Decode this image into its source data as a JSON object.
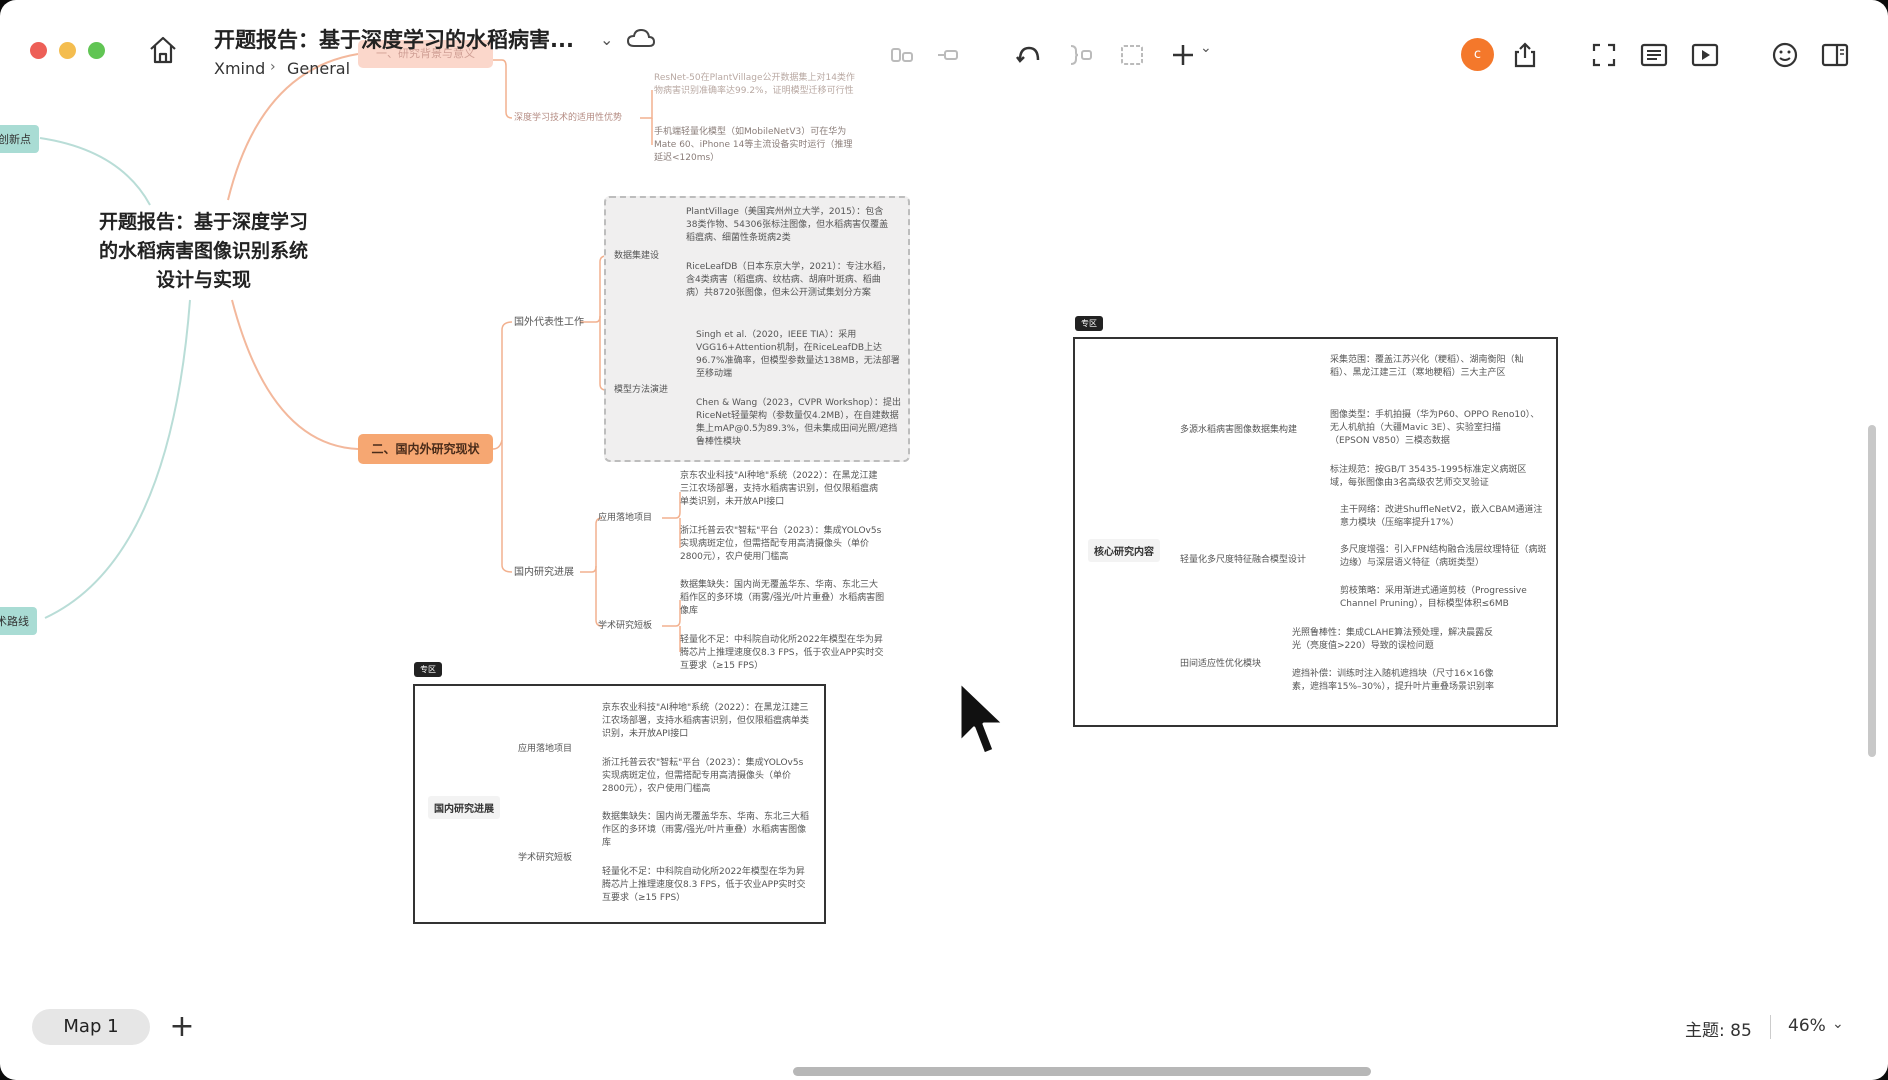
{
  "title_bar": {
    "doc_title": "开题报告：基于深度学习的水稻病害...",
    "breadcrumb": [
      "Xmind",
      "General"
    ],
    "avatar_letter": "c"
  },
  "toolbar_icons": [
    "relationship-icon",
    "boundary-icon",
    "undo-icon",
    "summary-icon",
    "frame-icon",
    "add-icon",
    "share-icon",
    "fullscreen-icon",
    "outline-icon",
    "play-icon",
    "emoji-icon",
    "panel-icon"
  ],
  "mindmap": {
    "root": "开题报告：基于深度学习的水稻病害图像识别系统设计与实现",
    "left_nodes": [
      "创新点",
      "术路线"
    ],
    "faded_node": "一、研究背景与意义",
    "top_faded_leaves": [
      "ResNet-50在PlantVillage公开数据集上对14类作物病害识别准确率达99.2%，证明模型迁移可行性",
      "手机端轻量化模型（如MobileNetV3）可在华为Mate 60、iPhone 14等主流设备实时运行（推理延迟<120ms）"
    ],
    "top_faded_branch": "深度学习技术的适用性优势",
    "domestic_status": "二、国内外研究现状",
    "foreign_work": "国外代表性工作",
    "dataset_build": "数据集建设",
    "model_evolution": "模型方法演进",
    "domestic_progress": "国内研究进展",
    "app_projects": "应用落地项目",
    "academic_gaps": "学术研究短板",
    "leaves": {
      "plantvillage": "PlantVillage（美国宾州州立大学，2015）：包含38类作物、54306张标注图像，但水稻病害仅覆盖稻瘟病、细菌性条斑病2类",
      "riceleaf": "RiceLeafDB（日本东京大学，2021）：专注水稻，含4类病害（稻瘟病、纹枯病、胡麻叶斑病、稻曲病）共8720张图像，但未公开测试集划分方案",
      "singh": "Singh et al.（2020，IEEE TIA）：采用VGG16+Attention机制，在RiceLeafDB上达96.7%准确率，但模型参数量达138MB，无法部署至移动端",
      "chen": "Chen & Wang（2023，CVPR Workshop）：提出RiceNet轻量架构（参数量仅4.2MB），在自建数据集上mAP@0.5为89.3%，但未集成田间光照/遮挡鲁棒性模块",
      "jd": "京东农业科技\"AI种地\"系统（2022）：在黑龙江建三江农场部署，支持水稻病害识别，但仅限稻瘟病单类识别，未开放API接口",
      "zj": "浙江托普云农\"智耘\"平台（2023）：集成YOLOv5s实现病斑定位，但需搭配专用高清摄像头（单价2800元），农户使用门槛高",
      "data_gap": "数据集缺失：国内尚无覆盖华东、华南、东北三大稻作区的多环境（雨雾/强光/叶片重叠）水稻病害图像库",
      "light_gap": "轻量化不足：中科院自动化所2022年模型在华为昇腾芯片上推理速度仅8.3 FPS，低于农业APP实时交互要求（≥15 FPS）"
    },
    "zone_tag": "专区",
    "zone1": {
      "center": "国内研究进展",
      "app_projects": "应用落地项目",
      "academic_gaps": "学术研究短板",
      "jd": "京东农业科技\"AI种地\"系统（2022）：在黑龙江建三江农场部署，支持水稻病害识别，但仅限稻瘟病单类识别，未开放API接口",
      "zj": "浙江托普云农\"智耘\"平台（2023）：集成YOLOv5s实现病斑定位，但需搭配专用高清摄像头（单价2800元），农户使用门槛高",
      "data_gap": "数据集缺失：国内尚无覆盖华东、华南、东北三大稻作区的多环境（雨雾/强光/叶片重叠）水稻病害图像库",
      "light_gap": "轻量化不足：中科院自动化所2022年模型在华为昇腾芯片上推理速度仅8.3 FPS，低于农业APP实时交互要求（≥15 FPS）"
    },
    "zone2": {
      "center": "核心研究内容",
      "branch1": "多源水稻病害图像数据集构建",
      "branch2": "轻量化多尺度特征融合模型设计",
      "branch3": "田间适应性优化模块",
      "leaf1": "采集范围：覆盖江苏兴化（粳稻）、湖南衡阳（籼稻）、黑龙江建三江（寒地粳稻）三大主产区",
      "leaf2": "图像类型：手机拍摄（华为P60、OPPO Reno10）、无人机航拍（大疆Mavic 3E）、实验室扫描（EPSON V850）三模态数据",
      "leaf3": "标注规范：按GB/T 35435-1995标准定义病斑区域，每张图像由3名高级农艺师交叉验证",
      "leaf4": "主干网络：改进ShuffleNetV2，嵌入CBAM通道注意力模块（压缩率提升17%）",
      "leaf5": "多尺度增强：引入FPN结构融合浅层纹理特征（病斑边缘）与深层语义特征（病斑类型）",
      "leaf6": "剪枝策略：采用渐进式通道剪枝（Progressive Channel Pruning），目标模型体积≤6MB",
      "leaf7": "光照鲁棒性：集成CLAHE算法预处理，解决晨露反光（亮度值>220）导致的误检问题",
      "leaf8": "遮挡补偿：训练时注入随机遮挡块（尺寸16×16像素，遮挡率15%–30%），提升叶片重叠场景识别率"
    }
  },
  "bottom_bar": {
    "map_tab": "Map 1",
    "add_tab": "+",
    "topic_count": "主题: 85",
    "zoom": "46%"
  }
}
